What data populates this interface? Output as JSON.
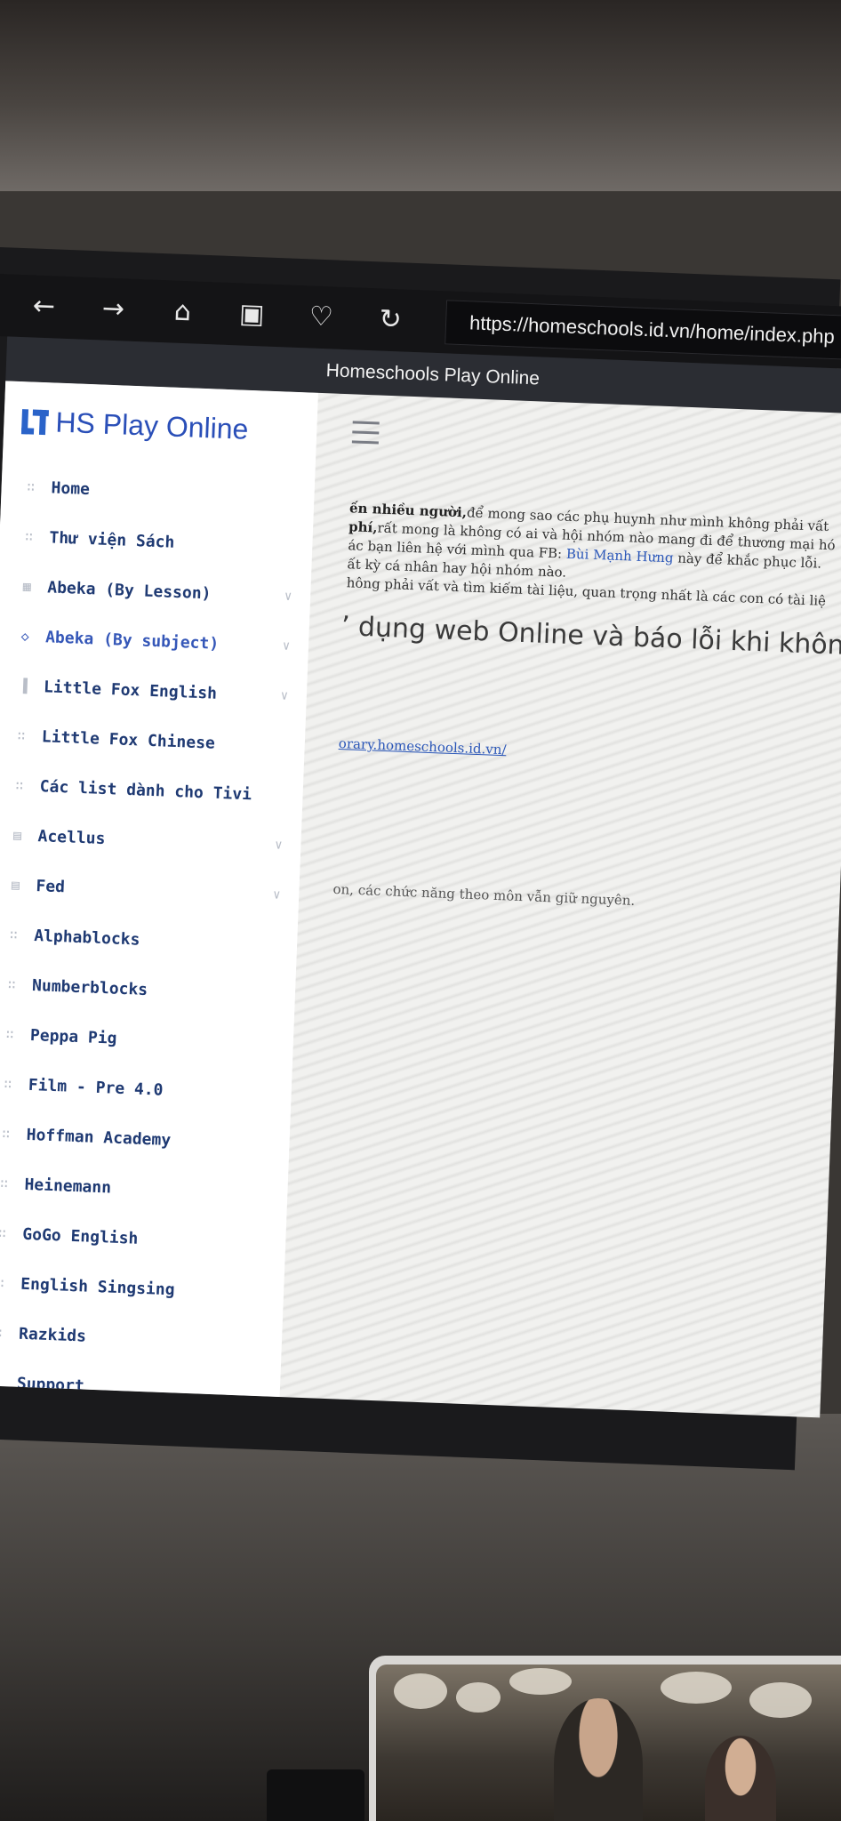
{
  "browser": {
    "back_icon": "←",
    "forward_icon": "→",
    "home_icon": "⌂",
    "toolbox_icon": "▣",
    "heart_icon": "♡",
    "reload_icon": "↻",
    "url": "https://homeschools.id.vn/home/index.php",
    "page_title": "Homeschools Play Online"
  },
  "brand": {
    "name": "HS Play Online"
  },
  "sidebar": {
    "items": [
      {
        "label": "Home",
        "icon": "grid-icon",
        "glyph": "∷",
        "chevron": ""
      },
      {
        "label": "Thư viện Sách",
        "icon": "grid-icon",
        "glyph": "∷",
        "chevron": ""
      },
      {
        "label": "Abeka (By Lesson)",
        "icon": "table-icon",
        "glyph": "▦",
        "chevron": "∨"
      },
      {
        "label": "Abeka (By subject)",
        "icon": "diamond-icon",
        "glyph": "◇",
        "chevron": "∨"
      },
      {
        "label": "Little Fox English",
        "icon": "bar-chart-icon",
        "glyph": "▐",
        "chevron": "∨"
      },
      {
        "label": "Little Fox Chinese",
        "icon": "grid-icon",
        "glyph": "∷",
        "chevron": ""
      },
      {
        "label": "Các list dành cho Tivi",
        "icon": "grid-icon",
        "glyph": "∷",
        "chevron": ""
      },
      {
        "label": "Acellus",
        "icon": "document-icon",
        "glyph": "▤",
        "chevron": "∨"
      },
      {
        "label": "Fed",
        "icon": "document-icon",
        "glyph": "▤",
        "chevron": "∨"
      },
      {
        "label": "Alphablocks",
        "icon": "grid-icon",
        "glyph": "∷",
        "chevron": ""
      },
      {
        "label": "Numberblocks",
        "icon": "grid-icon",
        "glyph": "∷",
        "chevron": ""
      },
      {
        "label": "Peppa Pig",
        "icon": "grid-icon",
        "glyph": "∷",
        "chevron": ""
      },
      {
        "label": "Film - Pre 4.0",
        "icon": "grid-icon",
        "glyph": "∷",
        "chevron": ""
      },
      {
        "label": "Hoffman Academy",
        "icon": "grid-icon",
        "glyph": "∷",
        "chevron": ""
      },
      {
        "label": "Heinemann",
        "icon": "grid-icon",
        "glyph": "∷",
        "chevron": ""
      },
      {
        "label": "GoGo English",
        "icon": "grid-icon",
        "glyph": "∷",
        "chevron": ""
      },
      {
        "label": "English Singsing",
        "icon": "grid-icon",
        "glyph": "∷",
        "chevron": ""
      },
      {
        "label": "Razkids",
        "icon": "grid-icon",
        "glyph": "∷",
        "chevron": ""
      },
      {
        "label": "Support",
        "icon": "grid-icon",
        "glyph": "∷",
        "chevron": ""
      }
    ]
  },
  "content": {
    "line1_bold": "ến nhiều người,",
    "line1_rest": "để mong sao các phụ huynh như mình không phải vất",
    "line2_bold": "phí,",
    "line2_rest": "rất mong là không có ai và hội nhóm nào mang đi để thương mại hó",
    "line3_pre": "ác bạn liên hệ với mình qua FB: ",
    "line3_link": "Bùi Mạnh Hưng",
    "line3_post": " này để khắc phục lỗi.",
    "line4": "ất kỳ cá nhân hay hội nhóm nào.",
    "line5": "hông phải vất và tìm kiếm tài liệu, quan trọng nhất là các con có tài liệ",
    "heading": "’ dụng web Online và báo lỗi khi không",
    "link": "orary.homeschools.id.vn/",
    "note": "on, các chức năng theo môn vẫn giữ nguyên."
  },
  "colors": {
    "brand_blue": "#2a63c9",
    "menu_text": "#1f3a73",
    "active_menu": "#3557b8",
    "title_bar": "#2b2d33",
    "browser_bar": "#141416"
  }
}
